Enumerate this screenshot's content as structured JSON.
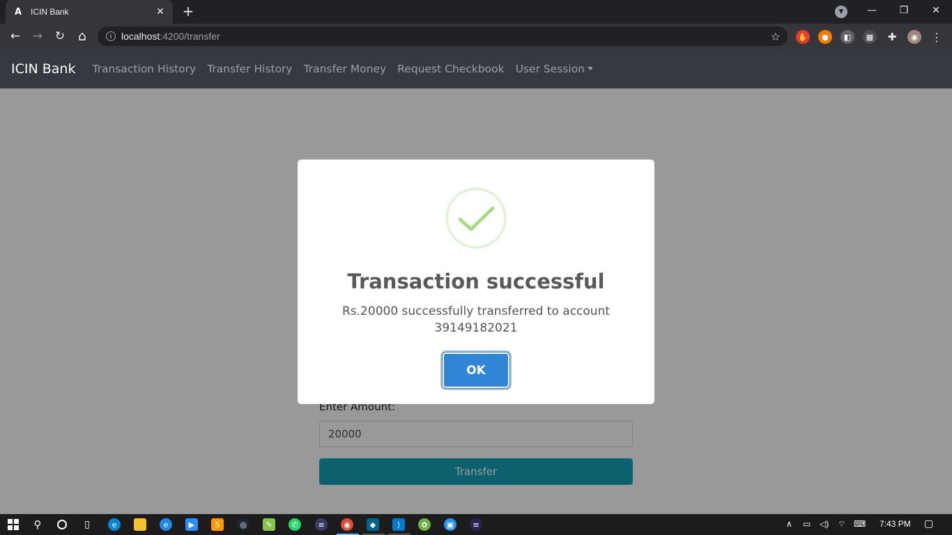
{
  "browser": {
    "tab_title": "ICIN Bank",
    "tab_favicon": "A",
    "tab_close": "✕",
    "new_tab": "+",
    "url_host": "localhost",
    "url_path": ":4200/transfer",
    "info_icon": "i",
    "star_icon": "☆",
    "back_icon": "←",
    "forward_icon": "→",
    "reload_icon": "↻",
    "home_icon": "⌂",
    "minimize_icon": "—",
    "restore_icon": "❐",
    "close_window_icon": "✕",
    "menu_icon": "⋮",
    "extensions_icon": "✚",
    "tab_search_icon": "▼"
  },
  "navbar": {
    "brand": "ICIN Bank",
    "links": [
      "Transaction History",
      "Transfer History",
      "Transfer Money",
      "Request Checkbook"
    ],
    "dropdown_label": "User Session"
  },
  "form": {
    "amount_label": "Enter Amount:",
    "amount_value": "20000",
    "submit_label": "Transfer"
  },
  "modal": {
    "title": "Transaction successful",
    "message": "Rs.20000 successfully transferred to account 39149182021",
    "confirm_label": "OK",
    "icon": "success-check-icon"
  },
  "taskbar": {
    "clock": "7:43 PM"
  },
  "colors": {
    "navbar_bg": "#343a40",
    "modal_button": "#3085d6",
    "transfer_button": "#17a2b8",
    "success_check": "#a5dc86"
  }
}
